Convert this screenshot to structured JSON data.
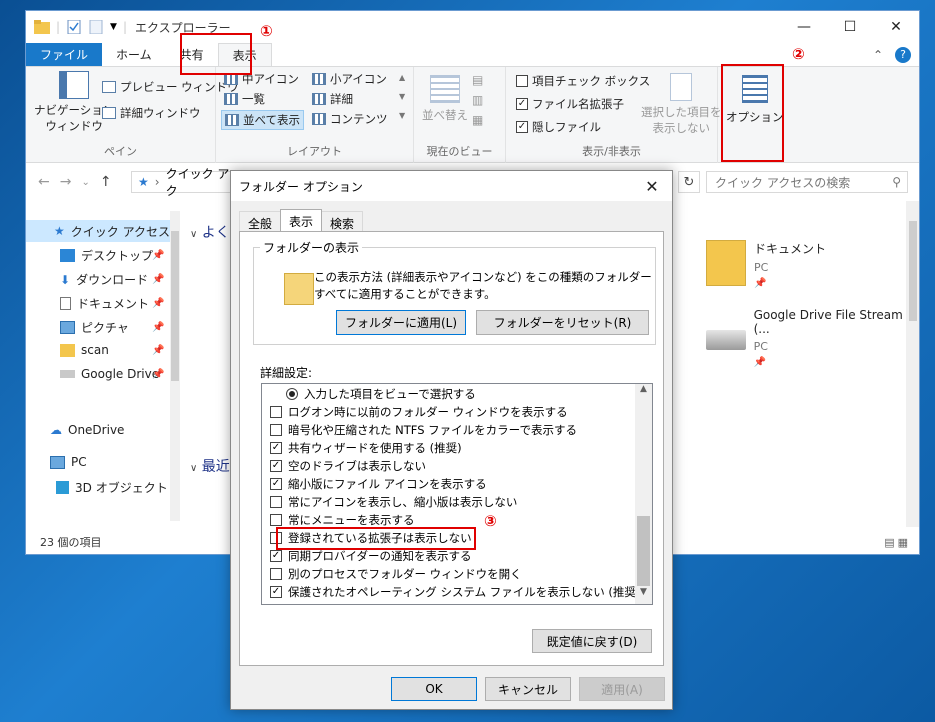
{
  "window": {
    "title": "エクスプローラー",
    "controls": [
      "—",
      "☐",
      "✕"
    ]
  },
  "ribbon": {
    "tabs": [
      "ファイル",
      "ホーム",
      "共有",
      "表示"
    ],
    "panes": {
      "nav_pane": "ナビゲーション\nウィンドウ",
      "preview": "プレビュー ウィンドウ",
      "details": "詳細ウィンドウ",
      "label": "ペイン"
    },
    "layout": {
      "items": [
        "中アイコン",
        "小アイコン",
        "一覧",
        "詳細",
        "並べて表示",
        "コンテンツ"
      ],
      "selected": "並べて表示",
      "label": "レイアウト"
    },
    "current_view": {
      "sort": "並べ替え",
      "label": "現在のビュー"
    },
    "show_hide": {
      "checkboxes": [
        {
          "label": "項目チェック ボックス",
          "checked": false
        },
        {
          "label": "ファイル名拡張子",
          "checked": true
        },
        {
          "label": "隠しファイル",
          "checked": true
        }
      ],
      "hide_selected": "選択した項目を\n表示しない",
      "label": "表示/非表示"
    },
    "options": "オプション"
  },
  "nav": {
    "address": "クイック アク",
    "search_placeholder": "クイック アクセスの検索"
  },
  "sidebar": {
    "items": [
      {
        "label": "クイック アクセス",
        "icon": "star-icon"
      },
      {
        "label": "デスクトップ",
        "icon": "desktop-icon"
      },
      {
        "label": "ダウンロード",
        "icon": "download-icon"
      },
      {
        "label": "ドキュメント",
        "icon": "document-icon"
      },
      {
        "label": "ピクチャ",
        "icon": "picture-icon"
      },
      {
        "label": "scan",
        "icon": "folder-icon"
      },
      {
        "label": "Google Drive",
        "icon": "drive-icon"
      },
      {
        "label": "OneDrive",
        "icon": "cloud-icon"
      },
      {
        "label": "PC",
        "icon": "pc-icon"
      },
      {
        "label": "3D オブジェクト",
        "icon": "cube-icon"
      }
    ]
  },
  "content": {
    "group1": "よく",
    "group2": "最近",
    "tiles": [
      {
        "name": "ドキュメント",
        "sub": "PC"
      },
      {
        "name": "Google Drive File Stream (...",
        "sub": "PC"
      }
    ]
  },
  "status": {
    "count": "23 個の項目"
  },
  "dialog": {
    "title": "フォルダー オプション",
    "tabs": [
      "全般",
      "表示",
      "検索"
    ],
    "folder_view": {
      "legend": "フォルダーの表示",
      "text": "この表示方法 (詳細表示やアイコンなど) をこの種類のフォルダーすべてに適用することができます。",
      "apply": "フォルダーに適用(L)",
      "reset": "フォルダーをリセット(R)"
    },
    "advanced_label": "詳細設定:",
    "advanced": [
      {
        "type": "radio",
        "label": "入力した項目をビューで選択する"
      },
      {
        "type": "check",
        "checked": false,
        "label": "ログオン時に以前のフォルダー ウィンドウを表示する"
      },
      {
        "type": "check",
        "checked": false,
        "label": "暗号化や圧縮された NTFS ファイルをカラーで表示する"
      },
      {
        "type": "check",
        "checked": true,
        "label": "共有ウィザードを使用する (推奨)"
      },
      {
        "type": "check",
        "checked": true,
        "label": "空のドライブは表示しない"
      },
      {
        "type": "check",
        "checked": true,
        "label": "縮小版にファイル アイコンを表示する"
      },
      {
        "type": "check",
        "checked": false,
        "label": "常にアイコンを表示し、縮小版は表示しない"
      },
      {
        "type": "check",
        "checked": false,
        "label": "常にメニューを表示する"
      },
      {
        "type": "check",
        "checked": false,
        "label": "登録されている拡張子は表示しない"
      },
      {
        "type": "check",
        "checked": true,
        "label": "同期プロバイダーの通知を表示する"
      },
      {
        "type": "check",
        "checked": false,
        "label": "別のプロセスでフォルダー ウィンドウを開く"
      },
      {
        "type": "check",
        "checked": true,
        "label": "保護されたオペレーティング システム ファイルを表示しない (推奨)"
      }
    ],
    "restore_defaults": "既定値に戻す(D)",
    "ok": "OK",
    "cancel": "キャンセル",
    "apply": "適用(A)"
  },
  "annotations": [
    "①",
    "②",
    "③"
  ],
  "colors": {
    "accent": "#1979ca",
    "highlight": "#e00000"
  }
}
